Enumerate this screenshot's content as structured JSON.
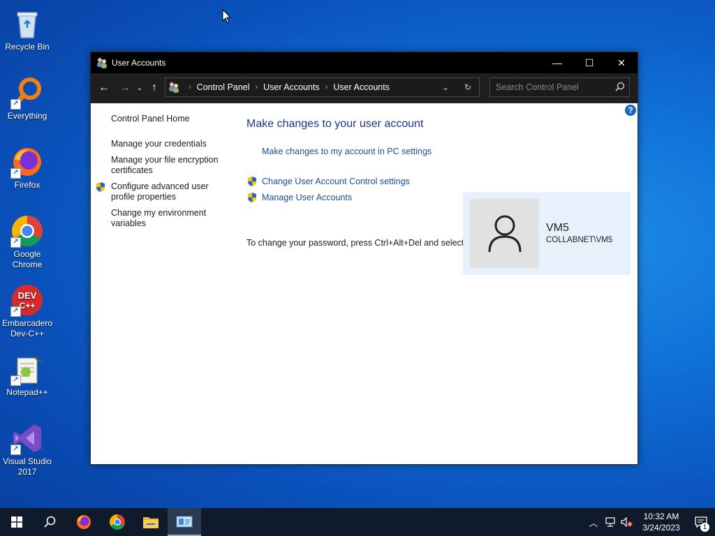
{
  "desktop": {
    "icons": [
      {
        "label": "Recycle Bin",
        "icon": "recycle-bin-icon",
        "shortcut": false
      },
      {
        "label": "Everything",
        "icon": "everything-search-icon",
        "shortcut": true
      },
      {
        "label": "Firefox",
        "icon": "firefox-icon",
        "shortcut": true
      },
      {
        "label": "Google Chrome",
        "icon": "chrome-icon",
        "shortcut": true
      },
      {
        "label": "Embarcadero Dev-C++",
        "icon": "devcpp-icon",
        "shortcut": true,
        "badge": "DEV C++"
      },
      {
        "label": "Notepad++",
        "icon": "notepadpp-icon",
        "shortcut": true
      },
      {
        "label": "Visual Studio 2017",
        "icon": "visual-studio-icon",
        "shortcut": true
      }
    ]
  },
  "window": {
    "title": "User Accounts",
    "controls": {
      "minimize": "—",
      "maximize": "☐",
      "close": "✕"
    },
    "nav": {
      "back": "←",
      "forward": "→",
      "recent": "⌄",
      "up": "↑"
    },
    "breadcrumb": [
      "Control Panel",
      "User Accounts",
      "User Accounts"
    ],
    "search": {
      "placeholder": "Search Control Panel"
    },
    "help": "?"
  },
  "left_pane": {
    "home": "Control Panel Home",
    "items": [
      {
        "label": "Manage your credentials",
        "shield": false
      },
      {
        "label": "Manage your file encryption certificates",
        "shield": false
      },
      {
        "label": "Configure advanced user profile properties",
        "shield": true
      },
      {
        "label": "Change my environment variables",
        "shield": false
      }
    ]
  },
  "main": {
    "title": "Make changes to your user account",
    "links": [
      {
        "label": "Make changes to my account in PC settings",
        "shield": false
      },
      {
        "label": "Change User Account Control settings",
        "shield": true
      },
      {
        "label": "Manage User Accounts",
        "shield": true
      }
    ],
    "note": "To change your password, press Ctrl+Alt+Del and select Change a password.",
    "user": {
      "name": "VM5",
      "domain": "COLLABNET\\VM5"
    }
  },
  "taskbar": {
    "time": "10:32 AM",
    "date": "3/24/2023",
    "notification_count": "1",
    "accent": "#76b9ed"
  }
}
